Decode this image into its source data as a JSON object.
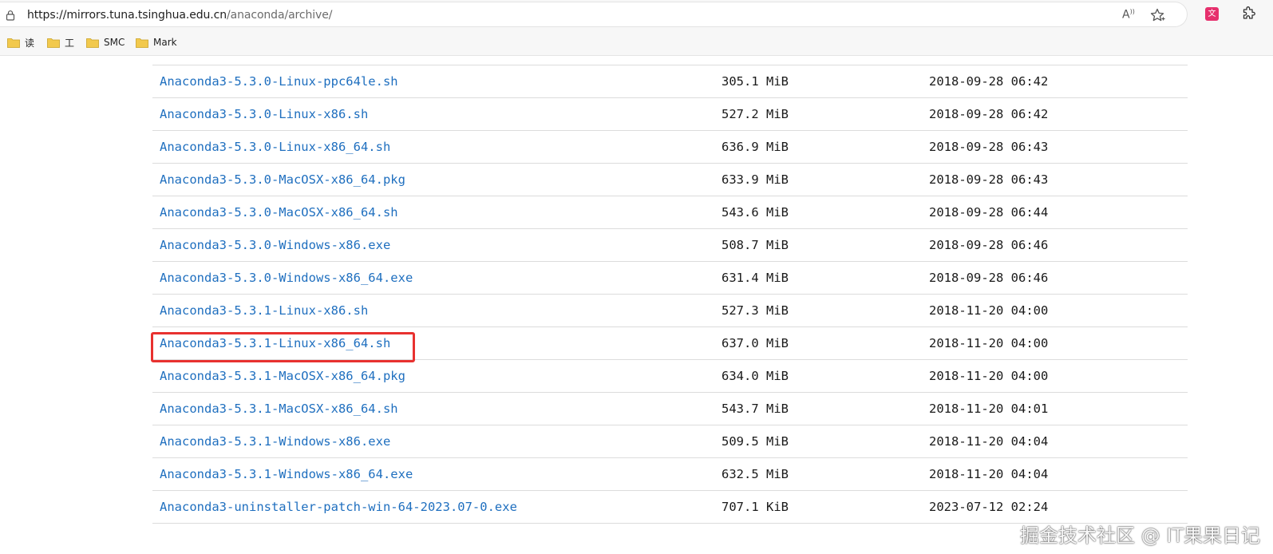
{
  "browser": {
    "url_host": "https://mirrors.tuna.tsinghua.edu.cn",
    "url_path": "/anaconda/archive/",
    "icons": [
      "lock-icon",
      "read-aloud-icon",
      "favorite-icon",
      "translate-icon",
      "extensions-icon"
    ]
  },
  "bookmarks": [
    {
      "label": "读"
    },
    {
      "label": "工"
    },
    {
      "label": "SMC"
    },
    {
      "label": "Mark"
    }
  ],
  "files": [
    {
      "name": "Anaconda3-5.3.0-Linux-ppc64le.sh",
      "size": "305.1 MiB",
      "date": "2018-09-28 06:42"
    },
    {
      "name": "Anaconda3-5.3.0-Linux-x86.sh",
      "size": "527.2 MiB",
      "date": "2018-09-28 06:42"
    },
    {
      "name": "Anaconda3-5.3.0-Linux-x86_64.sh",
      "size": "636.9 MiB",
      "date": "2018-09-28 06:43"
    },
    {
      "name": "Anaconda3-5.3.0-MacOSX-x86_64.pkg",
      "size": "633.9 MiB",
      "date": "2018-09-28 06:43"
    },
    {
      "name": "Anaconda3-5.3.0-MacOSX-x86_64.sh",
      "size": "543.6 MiB",
      "date": "2018-09-28 06:44"
    },
    {
      "name": "Anaconda3-5.3.0-Windows-x86.exe",
      "size": "508.7 MiB",
      "date": "2018-09-28 06:46"
    },
    {
      "name": "Anaconda3-5.3.0-Windows-x86_64.exe",
      "size": "631.4 MiB",
      "date": "2018-09-28 06:46"
    },
    {
      "name": "Anaconda3-5.3.1-Linux-x86.sh",
      "size": "527.3 MiB",
      "date": "2018-11-20 04:00"
    },
    {
      "name": "Anaconda3-5.3.1-Linux-x86_64.sh",
      "size": "637.0 MiB",
      "date": "2018-11-20 04:00"
    },
    {
      "name": "Anaconda3-5.3.1-MacOSX-x86_64.pkg",
      "size": "634.0 MiB",
      "date": "2018-11-20 04:00"
    },
    {
      "name": "Anaconda3-5.3.1-MacOSX-x86_64.sh",
      "size": "543.7 MiB",
      "date": "2018-11-20 04:01"
    },
    {
      "name": "Anaconda3-5.3.1-Windows-x86.exe",
      "size": "509.5 MiB",
      "date": "2018-11-20 04:04"
    },
    {
      "name": "Anaconda3-5.3.1-Windows-x86_64.exe",
      "size": "632.5 MiB",
      "date": "2018-11-20 04:04"
    },
    {
      "name": "Anaconda3-uninstaller-patch-win-64-2023.07-0.exe",
      "size": "707.1 KiB",
      "date": "2023-07-12 02:24"
    }
  ],
  "highlight": {
    "color": "#e8312f"
  },
  "colors": {
    "link": "#1f6fbf",
    "folder": "#f2c94c"
  },
  "watermark": "掘金技术社区 @ IT果果日记"
}
